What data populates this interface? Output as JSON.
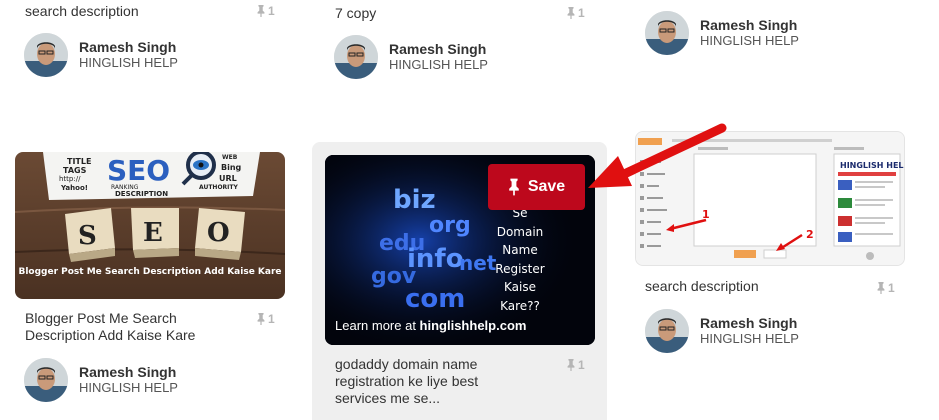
{
  "author": {
    "name": "Ramesh Singh",
    "board": "HINGLISH HELP"
  },
  "icons": {
    "pin": "pushpin-icon",
    "save_pin": "pushpin-icon",
    "arrow": "red-arrow"
  },
  "colors": {
    "save_button": "#bd081c",
    "hover_panel": "#efefef",
    "count": "#b5b5b5",
    "arrow": "#e01010"
  },
  "cards": {
    "c1_top": {
      "title": "search description",
      "repins": "1"
    },
    "c2_top": {
      "title": "7 copy",
      "repins": "1"
    },
    "c1_mid": {
      "title": "Blogger Post Me Search Description Add Kaise Kare",
      "repins": "1",
      "image_caption": "Blogger Post Me Search Description Add Kaise Kare",
      "image_words": [
        "SEO",
        "TITLE",
        "TAGS",
        "http://",
        "WEB",
        "Bing",
        "URL",
        "Yahoo!",
        "RANKING",
        "AUTHORITY",
        "DESCRIPTION",
        "S",
        "E",
        "O"
      ]
    },
    "c2_mid": {
      "title": "godaddy domain name registration ke liye best services me se...",
      "repins": "1",
      "save_label": "Save",
      "learn_more_prefix": "Learn more at ",
      "learn_more_domain": "hinglishhelp.com",
      "image_text": [
        "Se",
        "Domain",
        "Name",
        "Register",
        "Kaise",
        "Kare??"
      ],
      "image_words": [
        "biz",
        "org",
        "edu",
        "info",
        "net",
        "gov",
        "com"
      ]
    },
    "c3_mid": {
      "title": "search description",
      "repins": "1",
      "callouts": [
        "1",
        "2"
      ]
    }
  }
}
